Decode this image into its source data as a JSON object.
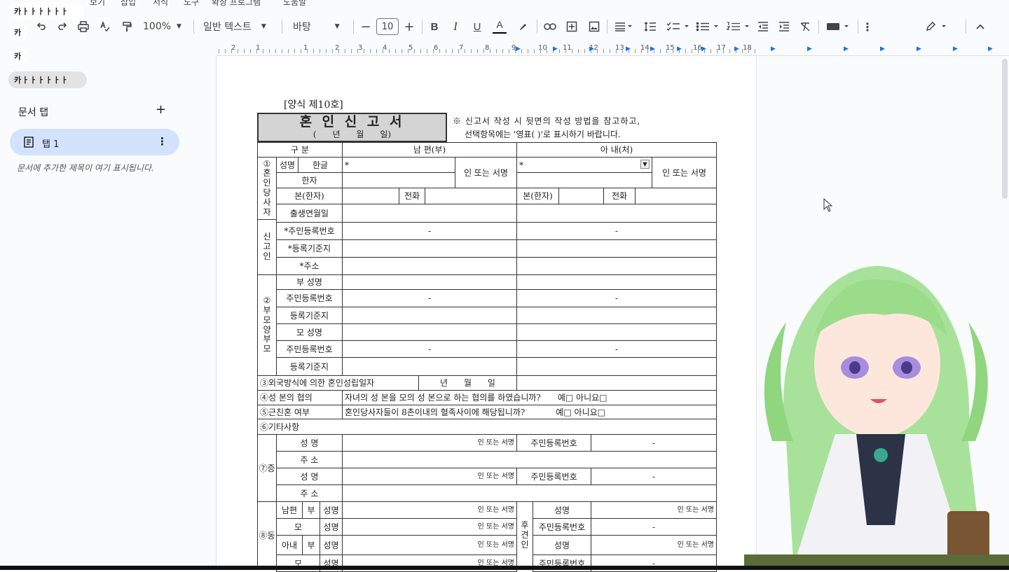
{
  "menu": {
    "items": [
      "보기",
      "삽입",
      "서식",
      "도구",
      "확장 프로그램",
      "도움말"
    ]
  },
  "badges": {
    "b1": "카ㅏㅏㅏㅏㅏㅏ",
    "b2": "카",
    "b3": "카",
    "b4": "카ㅏㅏㅏㅏㅏㅏ"
  },
  "toolbar": {
    "zoom": "100%",
    "style": "일반 텍스트",
    "font": "바탕",
    "font_size": "10",
    "minus": "−",
    "plus": "+",
    "bold": "B",
    "italic": "I",
    "underline": "U",
    "text_color": "A",
    "more": "⋮"
  },
  "ruler": {
    "numbers": [
      "2",
      "1",
      "1",
      "2",
      "3",
      "4",
      "5",
      "6",
      "7",
      "8",
      "9",
      "10",
      "11",
      "12",
      "13",
      "14",
      "15",
      "16",
      "17",
      "18"
    ]
  },
  "sidebar": {
    "title": "문서 탭",
    "add": "+",
    "tab_label": "탭 1",
    "tab_more": "⋮",
    "hint": "문서에 추가한 제목이 여기 표시됩니다."
  },
  "form": {
    "form_no": "[양식 제10호]",
    "title": "혼 인 신 고 서",
    "date_line": "(      년      월      일)",
    "notice_1": "※ 신고서 작성 시 뒷면의 작성 방법을 참고하고,",
    "notice_2": "선택항목에는 '영표(  )'로 표시하기 바랍니다.",
    "col_div": "구 분",
    "col_husband": "남      편(부)",
    "col_wife": "아      내(처)",
    "sec1_top": [
      "①",
      "혼",
      "인",
      "당",
      "사",
      "자"
    ],
    "sec1_bottom": [
      "신",
      "고",
      "인"
    ],
    "name": "성명",
    "hangul": "한글",
    "hanja": "한자",
    "star": "*",
    "seal": "인 또는 서명",
    "bon": "본(한자)",
    "phone": "전화",
    "birth": "출생연월일",
    "resident_no": "*주민등록번호",
    "dash": "-",
    "reg_base": "*등록기준지",
    "address": "*주소",
    "sec2": [
      "②",
      "부",
      "모",
      "양",
      "부",
      "모"
    ],
    "father_name": "부 성명",
    "resident_no2": "주민등록번호",
    "reg_base2": "등록기준지",
    "mother_name": "모 성명",
    "row3": "③외국방식에 의한 혼인성립일자",
    "row3_date": "년      월      일",
    "row4": "④성 본의 협의",
    "row4_q": "자녀의 성 본을 모의 성 본으로 하는 협의를 하였습니까?",
    "yesno": "예□ 아니요□",
    "row5": "⑤근친혼 여부",
    "row5_q": "혼인당사자들이 8촌이내의 혈족사이에 해당됩니까?",
    "row6": "⑥기타사항",
    "sec7": "⑦증",
    "name_spaced": "성 명",
    "addr_spaced": "주 소",
    "seal_small": "인 또는 서명",
    "sec8": "⑧동",
    "husband": "남편",
    "wife": "아내",
    "fu": "부",
    "mo": "모",
    "guardian": [
      "후",
      "견",
      "인"
    ],
    "name2": "성명"
  },
  "colors": {
    "accent": "#1a73e8",
    "tab_bg": "#d3e3fd",
    "page": "#ffffff",
    "bg": "#f9fbfd"
  }
}
